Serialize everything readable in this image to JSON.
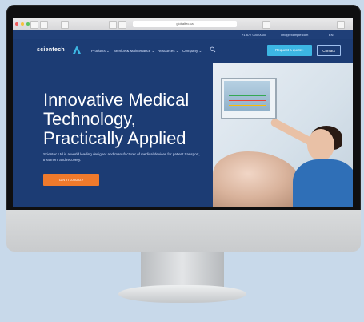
{
  "browser": {
    "url": "globaltec.ca"
  },
  "topbar": {
    "phone": "+1 877 000 0000",
    "email": "info@example.com",
    "lang": "EN"
  },
  "nav": {
    "logo": "scientech",
    "items": [
      "Products ⌄",
      "Service & Maintenance ⌄",
      "Resources ⌄",
      "Company ⌄"
    ],
    "cta": "Request a quote ›",
    "contact": "Contact"
  },
  "hero": {
    "title": "Innovative Medical Technology, Practically Applied",
    "subtitle": "Scientec Ltd is a world leading designer and manufacturer of medical devices for patient transport, treatment and recovery.",
    "button": "Get in contact ›"
  },
  "colors": {
    "brand": "#1c3c74",
    "accent": "#3cb6e3",
    "cta": "#ef7a2c"
  }
}
